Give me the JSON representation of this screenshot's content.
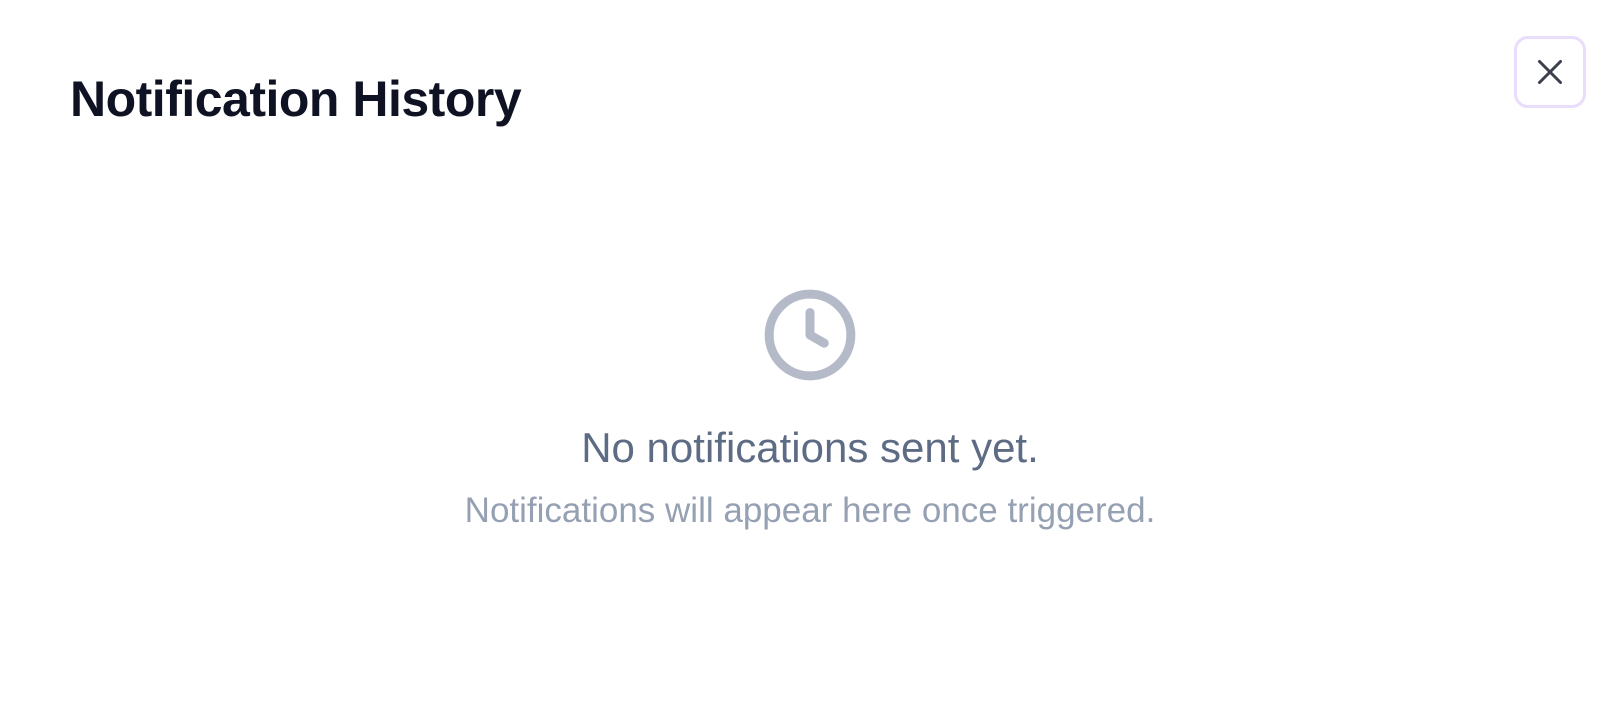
{
  "dialog": {
    "title": "Notification History",
    "close_icon": "close-icon"
  },
  "empty_state": {
    "icon": "clock-icon",
    "message": "No notifications sent yet.",
    "hint": "Notifications will appear here once triggered."
  },
  "colors": {
    "title": "#0f1222",
    "message": "#5d6c84",
    "hint": "#95a0b3",
    "icon": "#b4bac8",
    "close_focus_ring": "#eadcfb"
  }
}
